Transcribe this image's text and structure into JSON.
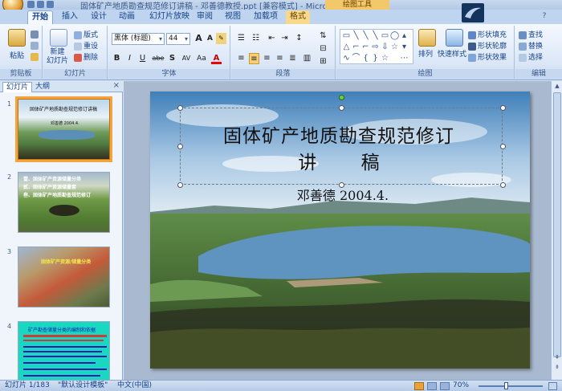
{
  "window": {
    "title": "固体矿产地质勘查规范修订讲稿 - 邓善德教授.ppt [兼容模式] - Microsoft PowerPoint",
    "context_tab_group": "绘图工具"
  },
  "tabs": [
    {
      "label": "开始",
      "active": true
    },
    {
      "label": "插入"
    },
    {
      "label": "设计"
    },
    {
      "label": "动画"
    },
    {
      "label": "幻灯片放映"
    },
    {
      "label": "审阅"
    },
    {
      "label": "视图"
    },
    {
      "label": "加载项"
    },
    {
      "label": "格式",
      "contextual": true
    }
  ],
  "ribbon": {
    "clipboard": {
      "label": "剪贴板",
      "paste": "粘贴"
    },
    "slides": {
      "label": "幻灯片",
      "new_slide": "新建\n幻灯片",
      "layout": "版式",
      "reset": "重设",
      "delete": "删除"
    },
    "font": {
      "label": "字体",
      "font_name": "黑体 (标题)",
      "font_size": "44",
      "bold": "B",
      "italic": "I",
      "underline": "U",
      "strike": "abe",
      "shadow": "S",
      "spacing": "AV",
      "case": "Aa",
      "color": "A",
      "grow": "A",
      "shrink": "A"
    },
    "paragraph": {
      "label": "段落"
    },
    "drawing": {
      "label": "绘图",
      "arrange": "排列",
      "quick_styles": "快速样式",
      "fill": "形状填充",
      "outline": "形状轮廓",
      "effects": "形状效果"
    },
    "editing": {
      "label": "编辑",
      "find": "查找",
      "replace": "替换",
      "select": "选择"
    }
  },
  "left_pane": {
    "tab_slides": "幻灯片",
    "tab_outline": "大纲",
    "close": "×",
    "thumbnails": [
      {
        "num": "1",
        "title": "固体矿产地质勘查规范修订讲稿",
        "sub": "邓善德  2004.4.",
        "selected": true
      },
      {
        "num": "2",
        "lines": [
          "壹、固体矿产资源储量分类",
          "贰、固体矿产资源储量套",
          "叁、固体矿产地质勘查规范修订"
        ]
      },
      {
        "num": "3",
        "title": "固体矿产资源/储量分类"
      },
      {
        "num": "4",
        "title": "矿产勘查储量分类的编制和依据"
      }
    ]
  },
  "slide": {
    "title_line1": "固体矿产地质勘查规范修订",
    "title_line2": "讲 稿",
    "subtitle": "邓善德    2004.4."
  },
  "statusbar": {
    "slide_info": "幻灯片 1/183",
    "theme": "\"默认设计模板\"",
    "language": "中文(中国)",
    "zoom": "70%"
  }
}
